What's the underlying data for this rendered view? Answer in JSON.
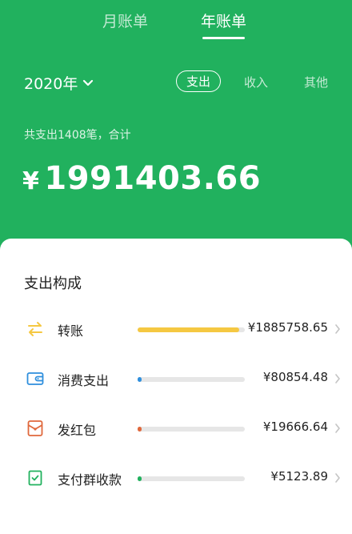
{
  "tabs": {
    "month": "月账单",
    "year": "年账单",
    "active": "year"
  },
  "year_selector": {
    "label": "2020年",
    "icon": "chevron-down-icon"
  },
  "type_tabs": {
    "expense": "支出",
    "income": "收入",
    "other": "其他",
    "active": "expense"
  },
  "summary": {
    "text": "共支出1408笔，合计",
    "total": "1991403.66",
    "currency": "¥"
  },
  "breakdown": {
    "title": "支出构成",
    "items": [
      {
        "label": "转账",
        "amount": "¥1885758.65",
        "fraction": 0.947,
        "color": "#f5c842",
        "icon": "transfer-icon"
      },
      {
        "label": "消费支出",
        "amount": "¥80854.48",
        "fraction": 0.041,
        "color": "#2f8fdd",
        "icon": "wallet-icon"
      },
      {
        "label": "发红包",
        "amount": "¥19666.64",
        "fraction": 0.01,
        "color": "#e0683c",
        "icon": "red-envelope-icon"
      },
      {
        "label": "支付群收款",
        "amount": "¥5123.89",
        "fraction": 0.003,
        "color": "#21b15e",
        "icon": "group-collection-icon"
      }
    ]
  },
  "colors": {
    "brand_green": "#21b15e"
  }
}
